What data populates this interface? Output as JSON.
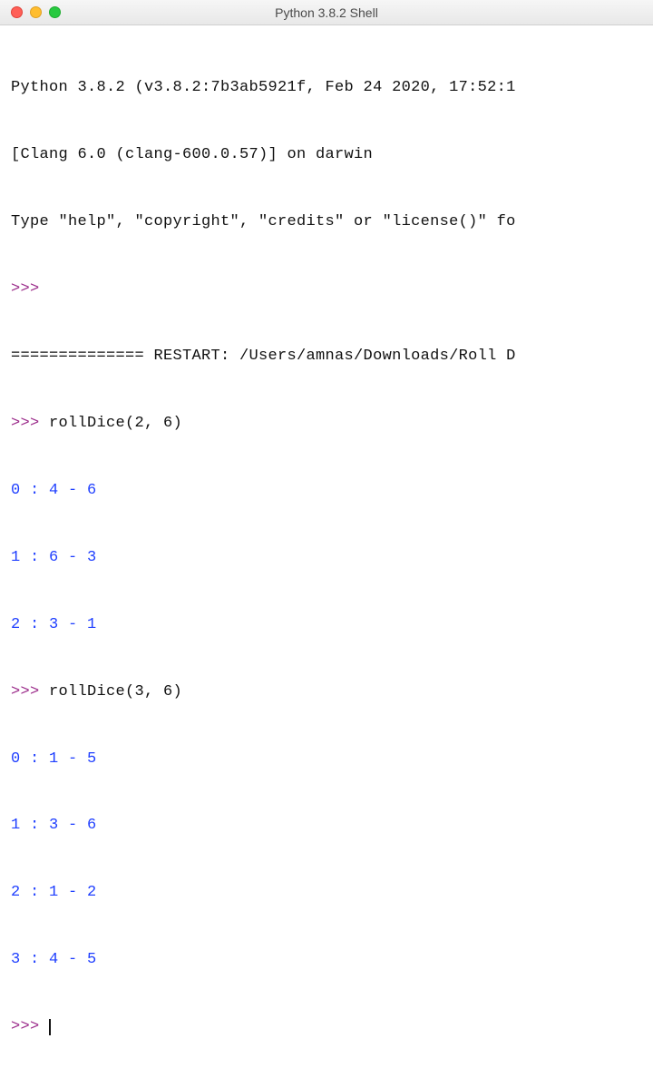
{
  "window": {
    "title": "Python 3.8.2 Shell"
  },
  "banner": {
    "line1": "Python 3.8.2 (v3.8.2:7b3ab5921f, Feb 24 2020, 17:52:1",
    "line2": "[Clang 6.0 (clang-600.0.57)] on darwin",
    "line3": "Type \"help\", \"copyright\", \"credits\" or \"license()\" fo"
  },
  "prompt": ">>> ",
  "restart": {
    "line": "============== RESTART: /Users/amnas/Downloads/Roll D"
  },
  "calls": [
    {
      "input": "rollDice(2, 6)",
      "output": [
        "0 : 4 - 6",
        "1 : 6 - 3",
        "2 : 3 - 1"
      ]
    },
    {
      "input": "rollDice(3, 6)",
      "output": [
        "0 : 1 - 5",
        "1 : 3 - 6",
        "2 : 1 - 2",
        "3 : 4 - 5"
      ]
    }
  ]
}
